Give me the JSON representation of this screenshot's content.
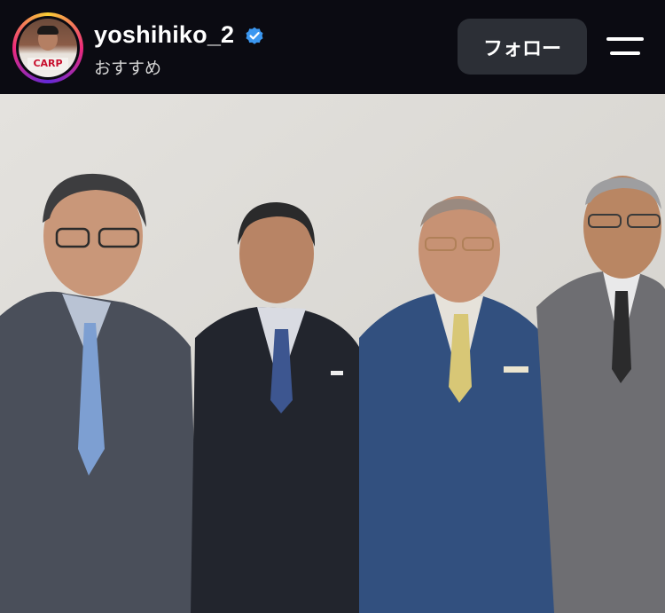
{
  "header": {
    "username": "yoshihiko_2",
    "subtitle": "おすすめ",
    "follow_label": "フォロー",
    "verified": true,
    "avatar_text": "CARP",
    "icons": {
      "verified": "verified-badge-icon",
      "menu": "menu-icon"
    }
  },
  "post": {
    "image_alt": "Four men in suits standing in front of a white wall"
  },
  "colors": {
    "background": "#0b0b12",
    "follow_button": "#2c2f36",
    "verified_blue": "#3b97f0",
    "text_primary": "#ffffff"
  }
}
